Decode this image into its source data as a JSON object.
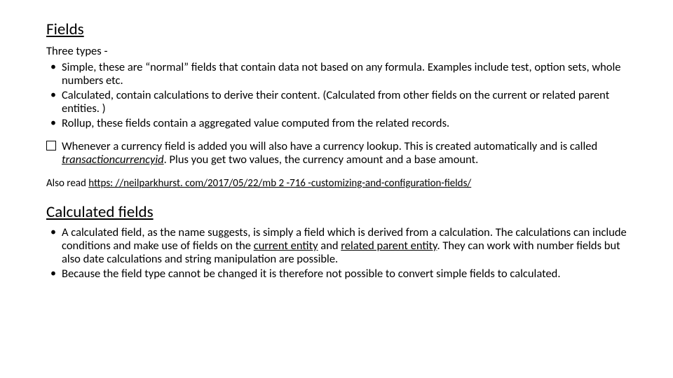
{
  "section1": {
    "title": "Fields",
    "intro": "Three types -",
    "bullets": [
      "Simple, these are “normal” fields that contain data not based on any formula. Examples include test, option sets, whole numbers etc.",
      "Calculated, contain calculations to derive their content. (Calculated from other fields on the current or related parent entities. )",
      "Rollup, these fields contain a aggregated value computed from the related records."
    ],
    "note_pre": "Whenever a currency field is added you will also have a currency lookup. This is created automatically and is called ",
    "note_italic": "transactioncurrencyid",
    "note_post": ". Plus you get two values, the currency amount and a base amount.",
    "also_prefix": "Also read ",
    "also_link_text": "https: //neilparkhurst. com/2017/05/22/mb 2 -716 -customizing-and-configuration-fields/"
  },
  "section2": {
    "title": "Calculated fields",
    "bullet1_pre": "A calculated field, as the name suggests, is simply a field which is derived from a calculation. The calculations can include conditions and make use of fields on the ",
    "bullet1_u1": "current entity",
    "bullet1_mid": " and ",
    "bullet1_u2": "related parent entity",
    "bullet1_post": ". They can work with number fields but also date calculations and string manipulation are possible.",
    "bullet2": "Because the field type cannot be changed it is therefore not possible to convert simple fields to calculated."
  }
}
